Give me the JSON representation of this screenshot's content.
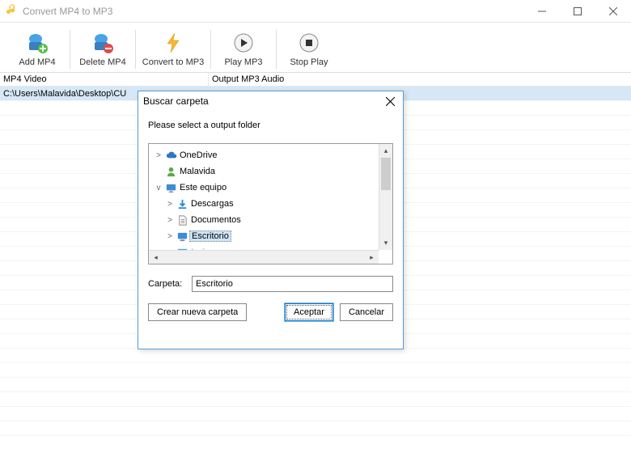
{
  "window": {
    "title": "Convert MP4 to MP3"
  },
  "toolbar": {
    "add": "Add MP4",
    "delete": "Delete MP4",
    "convert": "Convert to MP3",
    "play": "Play MP3",
    "stop": "Stop Play"
  },
  "columns": {
    "left": "MP4 Video",
    "right": "Output MP3 Audio"
  },
  "rows": [
    {
      "path": "C:\\Users\\Malavida\\Desktop\\CU"
    }
  ],
  "dialog": {
    "title": "Buscar carpeta",
    "instruction": "Please select a output folder",
    "tree": [
      {
        "label": "OneDrive",
        "expander": ">",
        "indent": 0,
        "icon": "cloud"
      },
      {
        "label": "Malavida",
        "expander": "",
        "indent": 0,
        "icon": "user"
      },
      {
        "label": "Este equipo",
        "expander": "v",
        "indent": 0,
        "icon": "monitor"
      },
      {
        "label": "Descargas",
        "expander": ">",
        "indent": 1,
        "icon": "download"
      },
      {
        "label": "Documentos",
        "expander": ">",
        "indent": 1,
        "icon": "document"
      },
      {
        "label": "Escritorio",
        "expander": ">",
        "indent": 1,
        "icon": "desktop",
        "selected": true
      },
      {
        "label": "Imágenes",
        "expander": ">",
        "indent": 1,
        "icon": "image",
        "cut": true
      }
    ],
    "folder_label": "Carpeta:",
    "folder_value": "Escritorio",
    "new_folder": "Crear nueva carpeta",
    "accept": "Aceptar",
    "cancel": "Cancelar"
  }
}
